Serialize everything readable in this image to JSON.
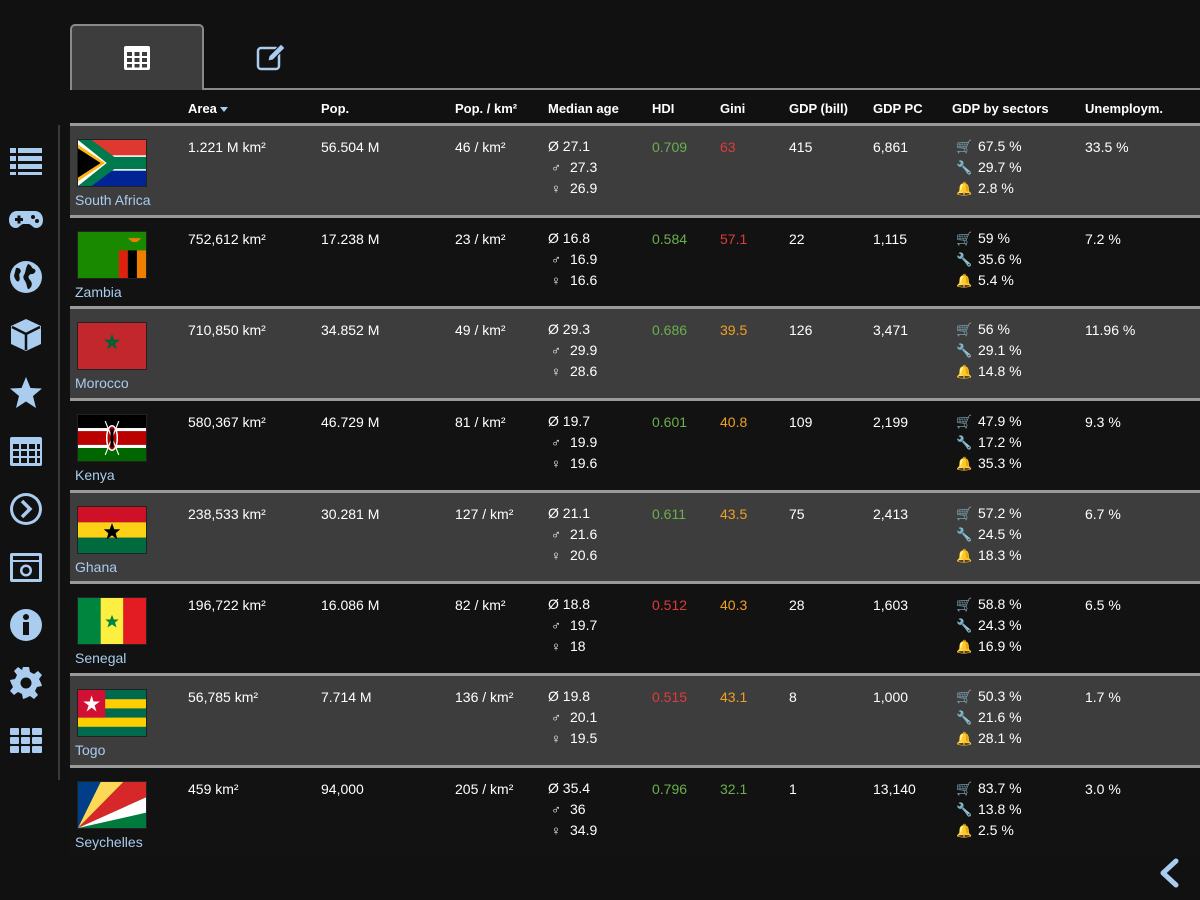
{
  "colors": {
    "accent": "#a9ccef",
    "good": "#6ab04c",
    "bad": "#e03a3a",
    "mid": "#f0a020"
  },
  "sidebar": {
    "items": [
      "list-icon",
      "gamepad-icon",
      "globe-icon",
      "cube-icon",
      "star-icon",
      "table-icon",
      "arrow-circle-icon",
      "photo-icon",
      "info-icon",
      "gear-icon",
      "grid-icon"
    ]
  },
  "tabs": [
    "table-icon",
    "edit-icon"
  ],
  "columns": {
    "area": "Area",
    "pop": "Pop.",
    "density": "Pop. / km²",
    "median": "Median age",
    "hdi": "HDI",
    "gini": "Gini",
    "gdp": "GDP (bill)",
    "gdppc": "GDP PC",
    "sectors": "GDP by sectors",
    "unemp": "Unemploym."
  },
  "rows": [
    {
      "name": "South Africa",
      "area": "1.221 M km²",
      "pop": "56.504 M",
      "density": "46 / km²",
      "age_avg": "Ø 27.1",
      "age_m": "27.3",
      "age_f": "26.9",
      "hdi": "0.709",
      "hdi_level": "good",
      "gini": "63",
      "gini_level": "bad",
      "gdp": "415",
      "gdppc": "6,861",
      "s1": "67.5 %",
      "s2": "29.7 %",
      "s3": "2.8 %",
      "unemp": "33.5 %"
    },
    {
      "name": "Zambia",
      "area": "752,612 km²",
      "pop": "17.238 M",
      "density": "23 / km²",
      "age_avg": "Ø 16.8",
      "age_m": "16.9",
      "age_f": "16.6",
      "hdi": "0.584",
      "hdi_level": "good",
      "gini": "57.1",
      "gini_level": "bad",
      "gdp": "22",
      "gdppc": "1,115",
      "s1": "59 %",
      "s2": "35.6 %",
      "s3": "5.4 %",
      "unemp": "7.2 %"
    },
    {
      "name": "Morocco",
      "area": "710,850 km²",
      "pop": "34.852 M",
      "density": "49 / km²",
      "age_avg": "Ø 29.3",
      "age_m": "29.9",
      "age_f": "28.6",
      "hdi": "0.686",
      "hdi_level": "good",
      "gini": "39.5",
      "gini_level": "mid",
      "gdp": "126",
      "gdppc": "3,471",
      "s1": "56 %",
      "s2": "29.1 %",
      "s3": "14.8 %",
      "unemp": "11.96 %"
    },
    {
      "name": "Kenya",
      "area": "580,367 km²",
      "pop": "46.729 M",
      "density": "81 / km²",
      "age_avg": "Ø 19.7",
      "age_m": "19.9",
      "age_f": "19.6",
      "hdi": "0.601",
      "hdi_level": "good",
      "gini": "40.8",
      "gini_level": "mid",
      "gdp": "109",
      "gdppc": "2,199",
      "s1": "47.9 %",
      "s2": "17.2 %",
      "s3": "35.3 %",
      "unemp": "9.3 %"
    },
    {
      "name": "Ghana",
      "area": "238,533 km²",
      "pop": "30.281 M",
      "density": "127 / km²",
      "age_avg": "Ø 21.1",
      "age_m": "21.6",
      "age_f": "20.6",
      "hdi": "0.611",
      "hdi_level": "good",
      "gini": "43.5",
      "gini_level": "mid",
      "gdp": "75",
      "gdppc": "2,413",
      "s1": "57.2 %",
      "s2": "24.5 %",
      "s3": "18.3 %",
      "unemp": "6.7 %"
    },
    {
      "name": "Senegal",
      "area": "196,722 km²",
      "pop": "16.086 M",
      "density": "82 / km²",
      "age_avg": "Ø 18.8",
      "age_m": "19.7",
      "age_f": "18",
      "hdi": "0.512",
      "hdi_level": "bad",
      "gini": "40.3",
      "gini_level": "mid",
      "gdp": "28",
      "gdppc": "1,603",
      "s1": "58.8 %",
      "s2": "24.3 %",
      "s3": "16.9 %",
      "unemp": "6.5 %"
    },
    {
      "name": "Togo",
      "area": "56,785 km²",
      "pop": "7.714 M",
      "density": "136 / km²",
      "age_avg": "Ø 19.8",
      "age_m": "20.1",
      "age_f": "19.5",
      "hdi": "0.515",
      "hdi_level": "bad",
      "gini": "43.1",
      "gini_level": "mid",
      "gdp": "8",
      "gdppc": "1,000",
      "s1": "50.3 %",
      "s2": "21.6 %",
      "s3": "28.1 %",
      "unemp": "1.7 %"
    },
    {
      "name": "Seychelles",
      "area": "459 km²",
      "pop": "94,000",
      "density": "205 / km²",
      "age_avg": "Ø 35.4",
      "age_m": "36",
      "age_f": "34.9",
      "hdi": "0.796",
      "hdi_level": "good",
      "gini": "32.1",
      "gini_level": "good",
      "gdp": "1",
      "gdppc": "13,140",
      "s1": "83.7 %",
      "s2": "13.8 %",
      "s3": "2.5 %",
      "unemp": "3.0 %"
    }
  ]
}
